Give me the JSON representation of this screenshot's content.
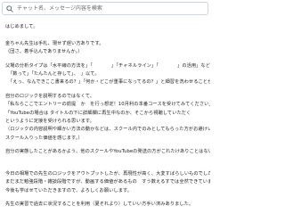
{
  "search": {
    "placeholder": "チャット名、メッセージ内容を検索"
  },
  "message": {
    "lines": [
      "はじめまして。",
      "",
      "金ちゃん先生は手札、現せず遅い方ありです。",
      "（団さ、着手込んでありませんか。）",
      "",
      "父場の分析タイプは「水平線の方法を」「　　　　」「チャネルライン」「　　　　」の活用」など乗りとしても",
      "「数って」「たんたんと存して」、　」以て。",
      "「えっ、なんできここ書来るの？」「何か・どこが重事になってるの？」と細習を洗わせることができると思います。",
      "",
      "自分のロジックを説明するのではなくて、",
      "「私ならここでエントリーの前提　か　を行っ想定！10月利の本番コースを受けてみてください」",
      "「YouTubeの場合は タイトルの下に詳細欄に再生中なのか、そこから視聴していただく",
      "というように定接を受けられる思います。",
      "（ロジックの内容説明や細かい方法の動かなどは、スクール内でのみとしてもらった方がお避けいただけるかと思いますので、その方がスクールの方も",
      "スクール入りった価値を感じます。）",
      "",
      "自分の実態したことがあるかよう、他のスクールやYouTubeの発送の方がこれたけありことはない見ます。",
      "",
      "",
      "今日の相場での先生のロジックをアウトプットしたが、再現性が高く、大変すばらしいものでした。",
      "まだまだ勉強段階・雑談段階ですが、動画する価値があるもの　すう数えるすでは全然できていません。",
      "今後も学ばせていただきますので、よろしくお願いします。",
      "",
      "先生の実習で過去に状況することを利用（夏それより）していい方手い済みありました。"
    ]
  }
}
